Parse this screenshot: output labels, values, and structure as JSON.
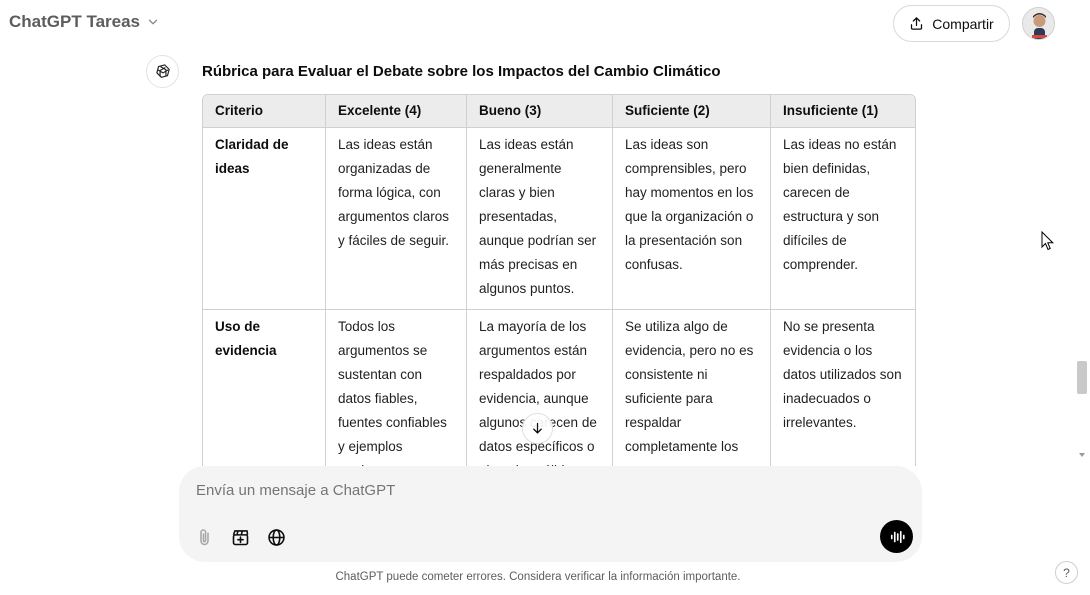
{
  "header": {
    "title": "ChatGPT Tareas",
    "share_label": "Compartir"
  },
  "message": {
    "heading": "Rúbrica para Evaluar el Debate sobre los Impactos del Cambio Climático"
  },
  "table": {
    "headers": [
      "Criterio",
      "Excelente (4)",
      "Bueno (3)",
      "Suficiente (2)",
      "Insuficiente (1)"
    ],
    "rows": [
      {
        "criterion": "Claridad de ideas",
        "cells": [
          "Las ideas están organizadas de forma lógica, con argumentos claros y fáciles de seguir.",
          "Las ideas están generalmente claras y bien presentadas, aunque podrían ser más precisas en algunos puntos.",
          "Las ideas son comprensibles, pero hay momentos en los que la organización o la presentación son confusas.",
          "Las ideas no están bien definidas, carecen de estructura y son difíciles de comprender."
        ]
      },
      {
        "criterion": "Uso de evidencia",
        "cells": [
          "Todos los argumentos se sustentan con datos fiables, fuentes confiables y ejemplos pertinentes.",
          "La mayoría de los argumentos están respaldados por evidencia, aunque algunos carecen de datos específicos o ejemplos sólidos.",
          "Se utiliza algo de evidencia, pero no es consistente ni suficiente para respaldar completamente los argumentos.",
          "No se presenta evidencia o los datos utilizados son inadecuados o irrelevantes."
        ]
      }
    ]
  },
  "composer": {
    "placeholder": "Envía un mensaje a ChatGPT"
  },
  "footer": {
    "disclaimer": "ChatGPT puede cometer errores. Considera verificar la información importante.",
    "help_label": "?"
  },
  "icons": {
    "attach": "paperclip-icon",
    "tools": "clapperboard-icon",
    "web": "globe-icon",
    "voice": "voice-wave-icon"
  }
}
